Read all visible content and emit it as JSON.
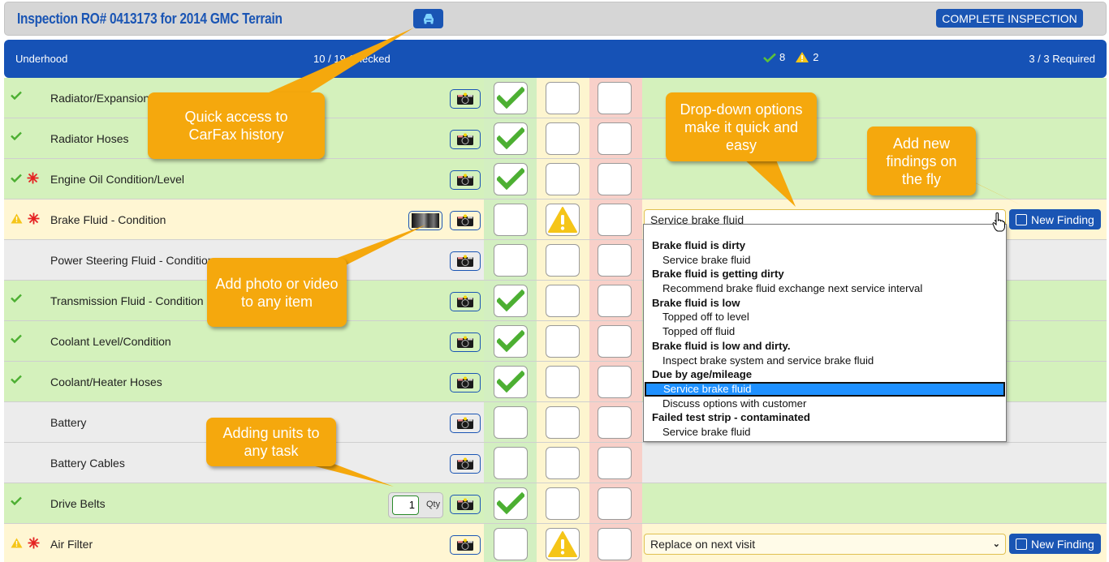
{
  "title_bar": {
    "title": "Inspection RO# 0413173 for 2014 GMC Terrain",
    "carfax_icon": "car-icon",
    "complete_button": "COMPLETE INSPECTION"
  },
  "section": {
    "name": "Underhood",
    "checked": "10 / 19 Checked",
    "pass_count": "8",
    "warn_count": "2",
    "required": "3 / 3 Required"
  },
  "colors": {
    "brand_blue": "#1a55b4",
    "pass_green": "#d4f1bc",
    "warn_yellow": "#fff6d3",
    "fail_red": "#f8d0c9",
    "callout_orange": "#f5a80d",
    "check_green": "#4caf32",
    "required_red": "#e52222"
  },
  "rows": [
    {
      "label": "Radiator/Expansion Tank Cap",
      "state": "pass",
      "required": false,
      "green": true,
      "yellow": false,
      "red": false
    },
    {
      "label": "Radiator Hoses",
      "state": "pass",
      "required": false,
      "green": true,
      "yellow": false,
      "red": false
    },
    {
      "label": "Engine Oil Condition/Level",
      "state": "pass",
      "required": true,
      "green": true,
      "yellow": false,
      "red": false
    },
    {
      "label": "Brake Fluid - Condition",
      "state": "warn",
      "required": true,
      "green": false,
      "yellow": true,
      "red": false,
      "has_media": true,
      "finding": "Service brake fluid",
      "new_finding": "New Finding"
    },
    {
      "label": "Power Steering Fluid - Condition",
      "state": "none",
      "required": false,
      "green": false,
      "yellow": false,
      "red": false
    },
    {
      "label": "Transmission Fluid - Condition",
      "state": "pass",
      "required": false,
      "green": true,
      "yellow": false,
      "red": false
    },
    {
      "label": "Coolant Level/Condition",
      "state": "pass",
      "required": false,
      "green": true,
      "yellow": false,
      "red": false
    },
    {
      "label": "Coolant/Heater Hoses",
      "state": "pass",
      "required": false,
      "green": true,
      "yellow": false,
      "red": false
    },
    {
      "label": "Battery",
      "state": "none",
      "required": false,
      "green": false,
      "yellow": false,
      "red": false
    },
    {
      "label": "Battery Cables",
      "state": "none",
      "required": false,
      "green": false,
      "yellow": false,
      "red": false
    },
    {
      "label": "Drive Belts",
      "state": "pass",
      "required": false,
      "green": true,
      "yellow": false,
      "red": false,
      "qty": "1",
      "qty_unit": "Qty"
    },
    {
      "label": "Air Filter",
      "state": "warn",
      "required": true,
      "green": false,
      "yellow": true,
      "red": false,
      "finding": "Replace on next visit",
      "new_finding": "New Finding"
    }
  ],
  "dropdown": {
    "items": [
      {
        "text": "Brake fluid is dirty",
        "type": "group"
      },
      {
        "text": "Service brake fluid",
        "type": "opt"
      },
      {
        "text": "Brake fluid is getting dirty",
        "type": "group"
      },
      {
        "text": "Recommend brake fluid exchange next service interval",
        "type": "opt"
      },
      {
        "text": "Brake fluid is low",
        "type": "group"
      },
      {
        "text": "Topped off to level",
        "type": "opt"
      },
      {
        "text": "Topped off fluid",
        "type": "opt"
      },
      {
        "text": "Brake fluid is low and dirty.",
        "type": "group"
      },
      {
        "text": "Inspect brake system and service brake fluid",
        "type": "opt"
      },
      {
        "text": "Due by age/mileage",
        "type": "group"
      },
      {
        "text": "Service brake fluid",
        "type": "opt",
        "selected": true
      },
      {
        "text": "Discuss options with customer",
        "type": "opt"
      },
      {
        "text": "Failed test strip - contaminated",
        "type": "group"
      },
      {
        "text": "Service brake fluid",
        "type": "opt"
      }
    ]
  },
  "callouts": {
    "carfax": "Quick access to CarFax history",
    "dropdown": "Drop-down options make it quick and easy",
    "new_finding": "Add new findings on the fly",
    "photo": "Add photo or video to any item",
    "units": "Adding units to any task"
  }
}
